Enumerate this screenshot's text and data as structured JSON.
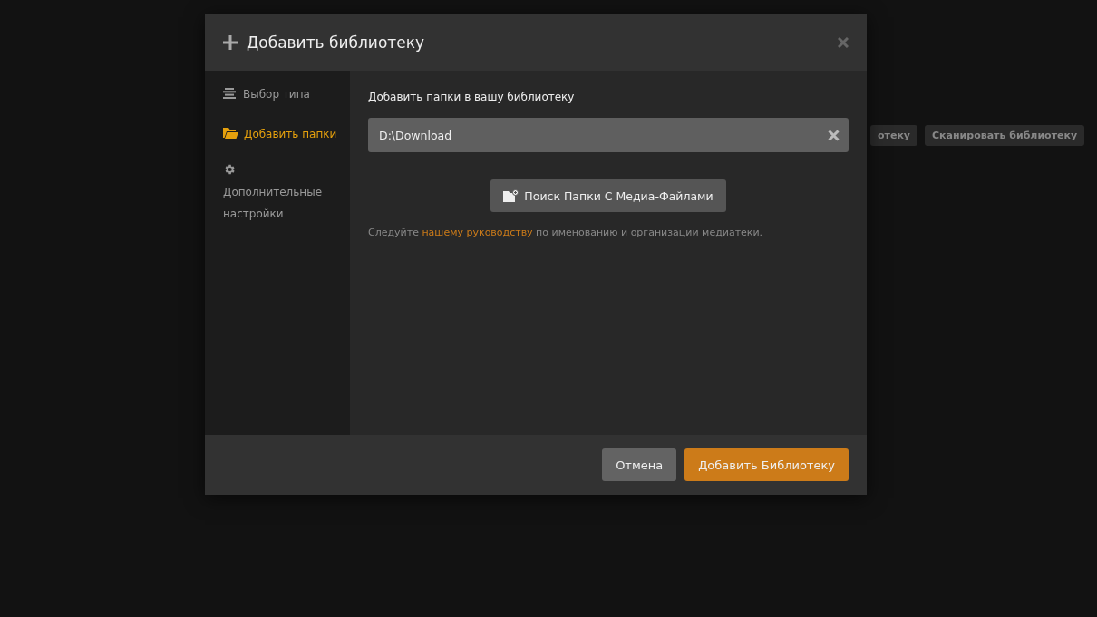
{
  "background_toolbar": {
    "buttons": [
      "отеку",
      "Сканировать библиотеку"
    ]
  },
  "modal": {
    "title": "Добавить библиотеку",
    "sidebar": {
      "items": [
        {
          "kind": "type",
          "label": "Выбор типа",
          "selected": false
        },
        {
          "kind": "folders",
          "label": "Добавить папки",
          "selected": true
        },
        {
          "kind": "advanced",
          "label": "Дополнительные настройки",
          "selected": false
        }
      ]
    },
    "heading": "Добавить папки в вашу библиотеку",
    "folders": [
      {
        "path": "D:\\Download"
      }
    ],
    "browse_button": "Поиск Папки С Медиа-Файлами",
    "hint": {
      "before": "Следуйте ",
      "link": "нашему руководству",
      "after": " по именованию и организации медиатеки."
    },
    "buttons": [
      {
        "kind": "secondary",
        "label": "Отмена"
      },
      {
        "kind": "primary",
        "label": "Добавить Библиотеку"
      }
    ]
  }
}
